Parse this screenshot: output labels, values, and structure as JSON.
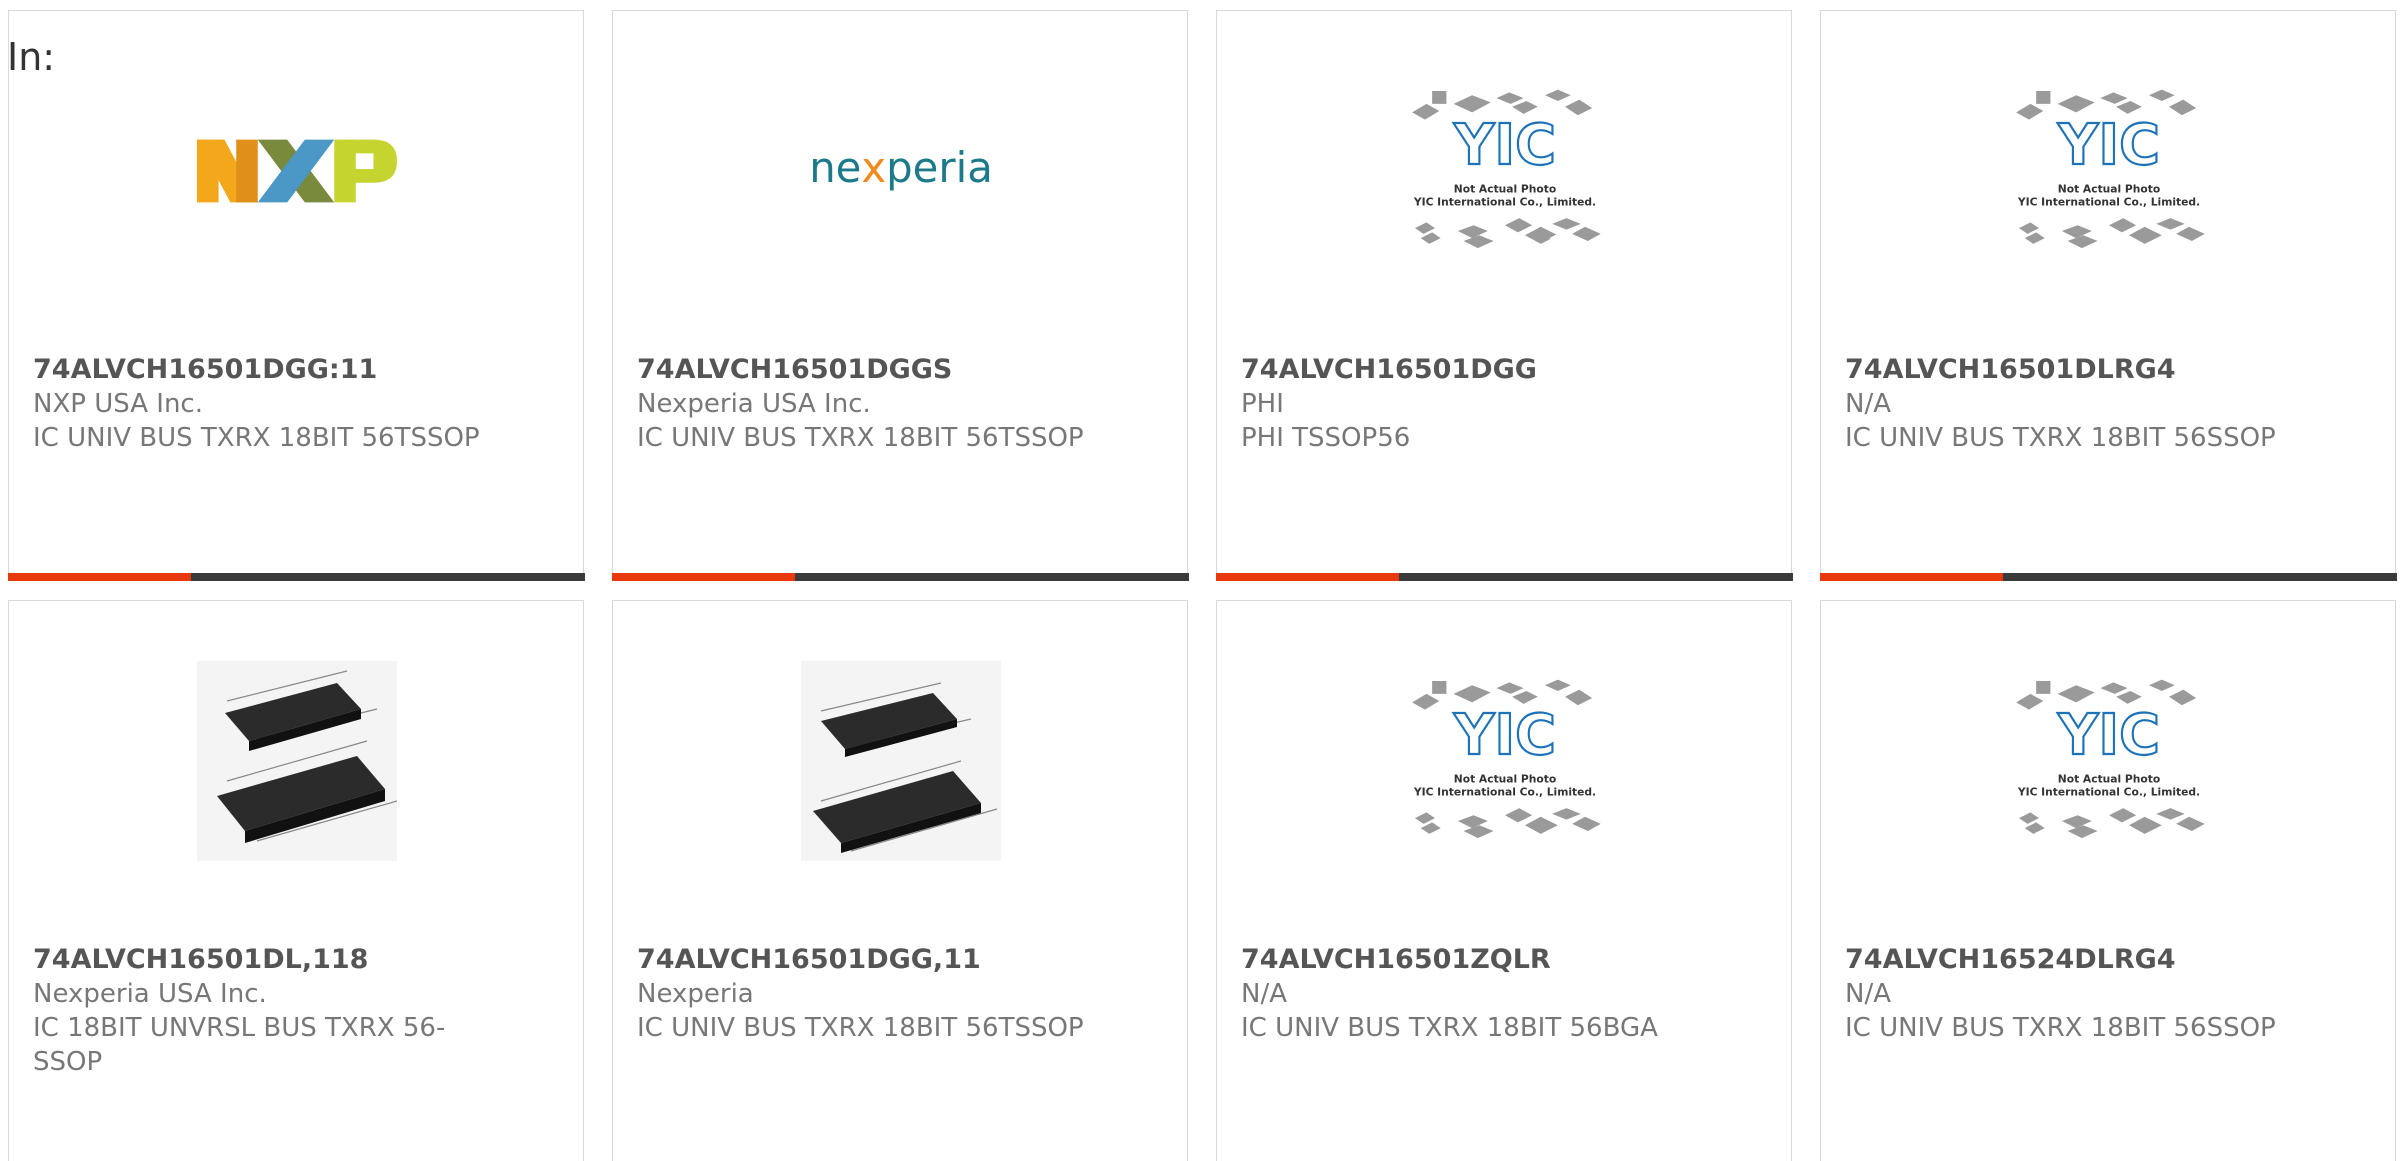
{
  "header": {
    "in_label": "In:"
  },
  "colors": {
    "accent_bar": "#e8380d",
    "bar_dark": "#3a3a3a",
    "nxp_orange": "#f3a81c",
    "nxp_blue": "#4b97c5",
    "nxp_green": "#c6d430",
    "nexperia_teal": "#1c7a8a",
    "nexperia_orange": "#f08a1c",
    "yic_blue": "#1d72b8"
  },
  "logos": {
    "nxp": "NXP",
    "nexperia_pre": "ne",
    "nexperia_x": "x",
    "nexperia_post": "peria",
    "yic": "YIC",
    "yic_line1": "Not Actual Photo",
    "yic_line2": "YIC International Co., Limited."
  },
  "products": [
    {
      "part": "74ALVCH16501DGG:11",
      "maker": "NXP USA Inc.",
      "desc": "IC UNIV BUS TXRX 18BIT 56TSSOP",
      "image": "nxp-logo"
    },
    {
      "part": "74ALVCH16501DGGS",
      "maker": "Nexperia USA Inc.",
      "desc": "IC UNIV BUS TXRX 18BIT 56TSSOP",
      "image": "nexperia-logo"
    },
    {
      "part": "74ALVCH16501DGG",
      "maker": "PHI",
      "desc": "PHI TSSOP56",
      "image": "yic-placeholder"
    },
    {
      "part": "74ALVCH16501DLRG4",
      "maker": "N/A",
      "desc": "IC UNIV BUS TXRX 18BIT 56SSOP",
      "image": "yic-placeholder"
    },
    {
      "part": "74ALVCH16501DL,118",
      "maker": "Nexperia USA Inc.",
      "desc": "IC 18BIT UNVRSL BUS TXRX 56-SSOP",
      "image": "chip-photo"
    },
    {
      "part": "74ALVCH16501DGG,11",
      "maker": "Nexperia",
      "desc": "IC UNIV BUS TXRX 18BIT 56TSSOP",
      "image": "chip-photo"
    },
    {
      "part": "74ALVCH16501ZQLR",
      "maker": "N/A",
      "desc": "IC UNIV BUS TXRX 18BIT 56BGA",
      "image": "yic-placeholder"
    },
    {
      "part": "74ALVCH16524DLRG4",
      "maker": "N/A",
      "desc": "IC UNIV BUS TXRX 18BIT 56SSOP",
      "image": "yic-placeholder"
    }
  ]
}
